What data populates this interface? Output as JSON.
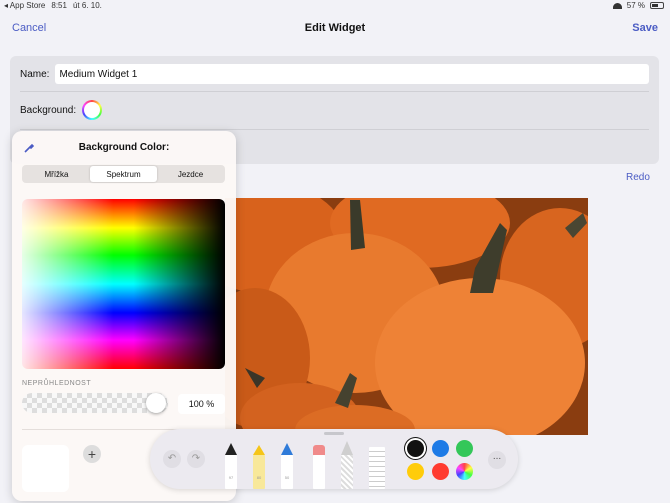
{
  "status": {
    "back_app": "◂ App Store",
    "time": "8:51",
    "date": "út 6. 10.",
    "battery": "57 %"
  },
  "nav": {
    "cancel": "Cancel",
    "title": "Edit Widget",
    "save": "Save"
  },
  "form": {
    "name_label": "Name:",
    "name_value": "Medium Widget 1",
    "background_label": "Background:"
  },
  "redo": "Redo",
  "picker": {
    "title": "Background Color:",
    "tabs": [
      "Mřížka",
      "Spektrum",
      "Jezdce"
    ],
    "selected_tab": "Spektrum",
    "opacity_label": "NEPRŮHLEDNOST",
    "opacity_value": "100 %",
    "opacity_fraction": 1.0,
    "add_symbol": "+"
  },
  "markup_toolbar": {
    "undo": "↶",
    "redo": "↷",
    "tools": [
      {
        "name": "pen",
        "tip_color": "#222222",
        "label": "97"
      },
      {
        "name": "highlighter",
        "tip_color": "#f5c518",
        "label": "80"
      },
      {
        "name": "pencil",
        "tip_color": "#2f7bd9",
        "label": "50"
      },
      {
        "name": "eraser",
        "tip_color": "#f08a8a",
        "label": ""
      },
      {
        "name": "lasso",
        "tip_color": "#bbbbbb",
        "label": ""
      },
      {
        "name": "ruler",
        "tip_color": "#dddddd",
        "label": ""
      }
    ],
    "colors": [
      "#111111",
      "#1e7be6",
      "#34c759",
      "#ffcc0a",
      "#ff3b30",
      "multicolor"
    ],
    "more": "..."
  }
}
